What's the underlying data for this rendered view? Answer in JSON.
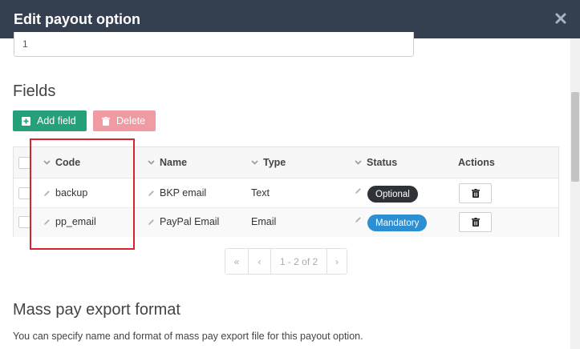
{
  "dialog": {
    "title": "Edit payout option",
    "close_icon": "close-icon"
  },
  "top_input": {
    "value": "1"
  },
  "fields": {
    "title": "Fields",
    "add_label": "Add field",
    "delete_label": "Delete"
  },
  "table": {
    "columns": [
      "Code",
      "Name",
      "Type",
      "Status",
      "Actions"
    ],
    "rows": [
      {
        "code": "backup",
        "name": "BKP email",
        "type": "Text",
        "status": "Optional"
      },
      {
        "code": "pp_email",
        "name": "PayPal Email",
        "type": "Email",
        "status": "Mandatory"
      }
    ]
  },
  "pagination": {
    "first": "«",
    "prev": "‹",
    "info": "1 - 2 of 2",
    "next": "›"
  },
  "mass_pay": {
    "title": "Mass pay export format",
    "description": "You can specify name and format of mass pay export file for this payout option."
  },
  "colors": {
    "header_bg": "#34404f",
    "add_button": "#26a07b",
    "delete_button": "#f09aa1",
    "badge_optional": "#2f3338",
    "badge_mandatory": "#2b8fd1",
    "highlight": "#d9232d"
  }
}
